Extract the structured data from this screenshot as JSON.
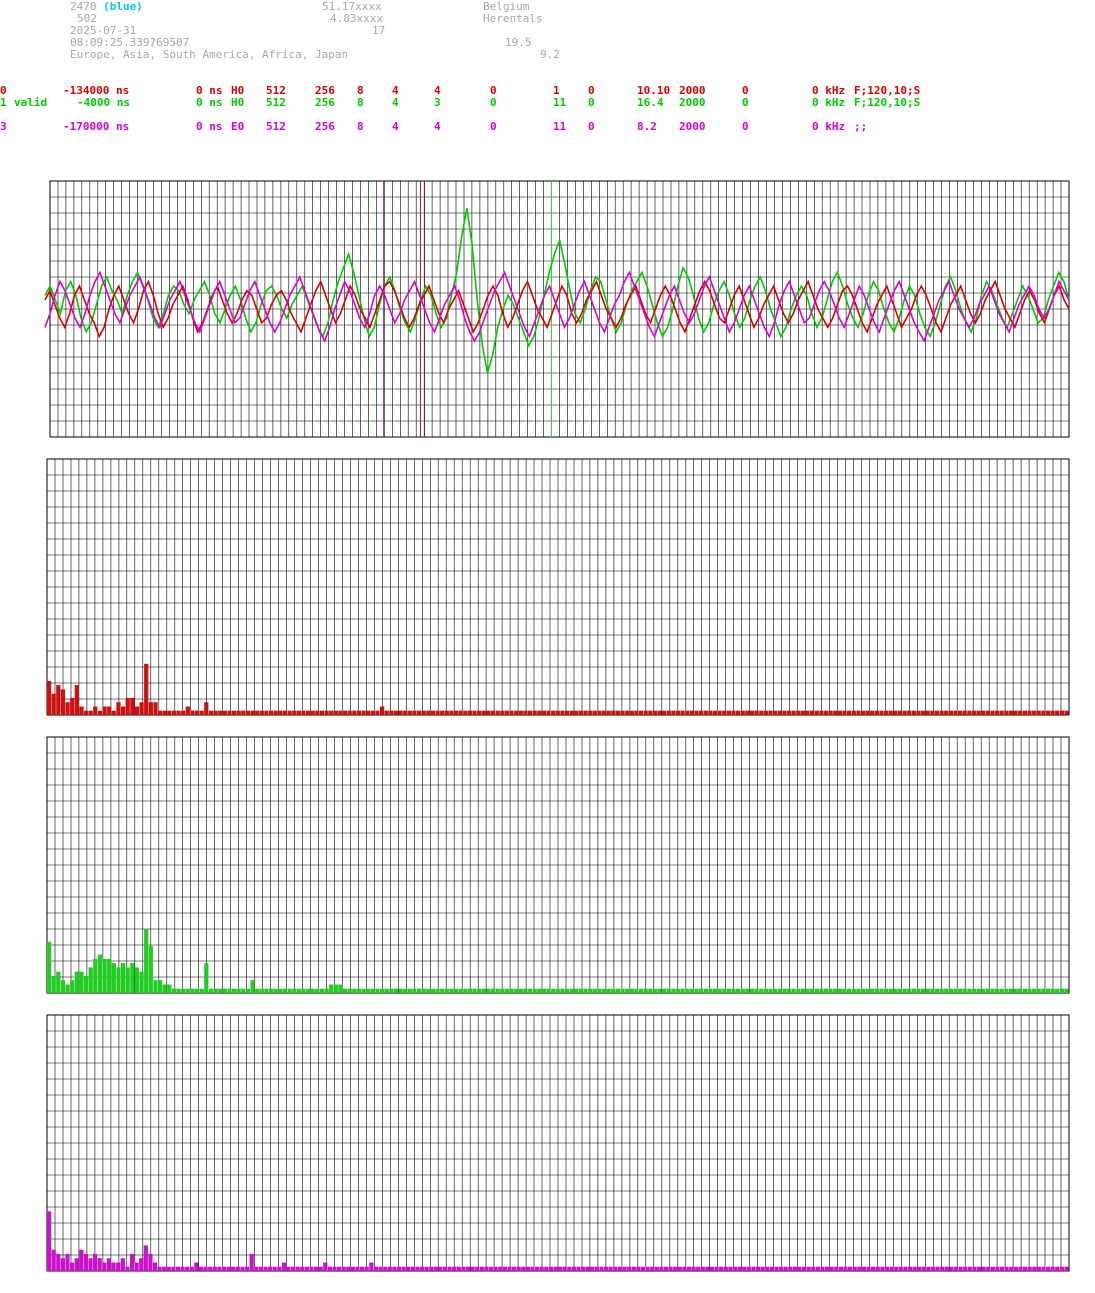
{
  "header": {
    "station_id": "2470",
    "station_color": "(blue)",
    "line2": "502",
    "date": "2025-07-31",
    "time": "08:09:25.339769507",
    "regions": "Europe, Asia, South America, Africa, Japan",
    "lat": "51.17xxxx",
    "lon": "4.83xxxx",
    "alt": "17",
    "country": "Belgium",
    "city": "Herentals",
    "val_a": "19.5",
    "val_b": "9.2"
  },
  "channels": [
    {
      "ch": "0",
      "valid": "",
      "delay": "-134000 ns",
      "off": "0 ns",
      "ant": "H0",
      "c1": "512",
      "c2": "256",
      "c3": "8",
      "c4": "4",
      "c5": "4",
      "c6": "0",
      "c7": "1",
      "c8": "0",
      "c9": "10.10",
      "c10": "2000",
      "c11": "0",
      "freq": "0 kHz",
      "filt": "F;120,10;S",
      "color": "#dd0000"
    },
    {
      "ch": "1",
      "valid": "valid",
      "delay": "-4000 ns",
      "off": "0 ns",
      "ant": "H0",
      "c1": "512",
      "c2": "256",
      "c3": "8",
      "c4": "4",
      "c5": "3",
      "c6": "0",
      "c7": "11",
      "c8": "0",
      "c9": "16.4",
      "c10": "2000",
      "c11": "0",
      "freq": "0 kHz",
      "filt": "F;120,10;S",
      "color": "#00cc00"
    },
    {
      "ch": "3",
      "valid": "",
      "delay": "-170000 ns",
      "off": "0 ns",
      "ant": "E0",
      "c1": "512",
      "c2": "256",
      "c3": "8",
      "c4": "4",
      "c5": "4",
      "c6": "0",
      "c7": "11",
      "c8": "0",
      "c9": "8.2",
      "c10": "2000",
      "c11": "0",
      "freq": "0 kHz",
      "filt": ";;",
      "color": "#dd00dd"
    }
  ],
  "chart_data": [
    {
      "type": "line",
      "grid": true,
      "series": [
        {
          "color": "#00cc00",
          "values": [
            3,
            5,
            2,
            -1,
            4,
            6,
            3,
            -2,
            -5,
            -3,
            1,
            5,
            7,
            4,
            2,
            -1,
            3,
            6,
            8,
            5,
            2,
            -2,
            -4,
            -1,
            3,
            5,
            4,
            1,
            -1,
            2,
            4,
            6,
            3,
            -1,
            -3,
            0,
            3,
            5,
            2,
            -2,
            -5,
            -3,
            1,
            4,
            5,
            3,
            0,
            -2,
            1,
            3,
            5,
            2,
            -1,
            -4,
            -6,
            -3,
            2,
            6,
            9,
            12,
            8,
            3,
            -2,
            -6,
            -4,
            1,
            5,
            7,
            4,
            0,
            -3,
            -5,
            -2,
            2,
            5,
            3,
            -1,
            -4,
            -2,
            3,
            8,
            16,
            22,
            14,
            2,
            -8,
            -14,
            -10,
            -4,
            0,
            3,
            1,
            -2,
            -5,
            -8,
            -6,
            -2,
            3,
            8,
            12,
            15,
            10,
            4,
            -1,
            -3,
            0,
            4,
            7,
            6,
            2,
            -2,
            -5,
            -3,
            1,
            4,
            6,
            8,
            5,
            1,
            -3,
            -6,
            -4,
            0,
            5,
            9,
            7,
            3,
            -2,
            -5,
            -3,
            1,
            4,
            6,
            3,
            -1,
            -4,
            -2,
            2,
            5,
            7,
            4,
            0,
            -3,
            -6,
            -4,
            0,
            3,
            5,
            3,
            -1,
            -4,
            -2,
            2,
            6,
            8,
            5,
            1,
            -2,
            -4,
            -1,
            3,
            6,
            4,
            0,
            -3,
            -5,
            -2,
            2,
            5,
            3,
            -1,
            -4,
            -6,
            -3,
            1,
            5,
            7,
            4,
            0,
            -3,
            -5,
            -2,
            3,
            6,
            4,
            1,
            -2,
            -4,
            -1,
            2,
            5,
            3,
            0,
            -3,
            -2,
            2,
            5,
            8,
            6,
            2
          ]
        },
        {
          "color": "#dd0000",
          "values": [
            2,
            4,
            1,
            -2,
            -4,
            -1,
            3,
            5,
            2,
            -1,
            -3,
            -6,
            -4,
            0,
            3,
            5,
            2,
            -1,
            -3,
            0,
            4,
            6,
            3,
            -1,
            -4,
            -2,
            1,
            3,
            5,
            2,
            -2,
            -5,
            -3,
            0,
            3,
            5,
            2,
            -1,
            -3,
            -1,
            2,
            4,
            3,
            0,
            -3,
            -2,
            1,
            3,
            4,
            2,
            -1,
            -3,
            -5,
            -2,
            1,
            4,
            6,
            3,
            0,
            -3,
            -1,
            2,
            5,
            3,
            0,
            -2,
            -4,
            -1,
            2,
            5,
            6,
            4,
            1,
            -2,
            -4,
            -2,
            1,
            3,
            5,
            2,
            -1,
            -3,
            0,
            2,
            4,
            1,
            -2,
            -5,
            -3,
            0,
            3,
            5,
            3,
            -1,
            -4,
            -2,
            1,
            4,
            6,
            3,
            0,
            -2,
            -4,
            -1,
            2,
            5,
            3,
            -1,
            -3,
            -1,
            2,
            4,
            6,
            3,
            0,
            -2,
            -4,
            -2,
            1,
            3,
            5,
            2,
            -1,
            -3,
            0,
            3,
            5,
            3,
            0,
            -3,
            -5,
            -2,
            1,
            4,
            6,
            4,
            1,
            -2,
            -3,
            0,
            3,
            5,
            2,
            -1,
            -4,
            -2,
            1,
            3,
            5,
            2,
            -1,
            -3,
            -1,
            2,
            4,
            6,
            3,
            0,
            -2,
            -4,
            -2,
            1,
            4,
            5,
            3,
            0,
            -3,
            -5,
            -2,
            1,
            3,
            5,
            2,
            -1,
            -4,
            -2,
            0,
            3,
            5,
            3,
            0,
            -3,
            -5,
            -2,
            1,
            3,
            5,
            2,
            -1,
            -3,
            -1,
            2,
            4,
            6,
            3,
            0,
            -2,
            -4,
            -1,
            2,
            4,
            2,
            -1,
            -3,
            0,
            3,
            5,
            2,
            0
          ]
        },
        {
          "color": "#dd00dd",
          "values": [
            -4,
            -1,
            3,
            6,
            4,
            1,
            -2,
            -4,
            -1,
            3,
            6,
            8,
            5,
            2,
            -1,
            -3,
            0,
            3,
            5,
            7,
            4,
            1,
            -2,
            -4,
            -1,
            2,
            4,
            6,
            3,
            0,
            -3,
            -5,
            -2,
            1,
            4,
            6,
            3,
            0,
            -3,
            -2,
            1,
            4,
            6,
            3,
            0,
            -3,
            -5,
            -3,
            0,
            3,
            5,
            7,
            4,
            1,
            -2,
            -5,
            -7,
            -4,
            0,
            3,
            6,
            4,
            1,
            -2,
            -4,
            -1,
            3,
            5,
            3,
            0,
            -3,
            -1,
            2,
            4,
            6,
            3,
            0,
            -3,
            -5,
            -2,
            1,
            3,
            5,
            2,
            -2,
            -5,
            -7,
            -5,
            -2,
            1,
            4,
            6,
            8,
            5,
            2,
            -1,
            -4,
            -6,
            -3,
            0,
            3,
            5,
            2,
            -1,
            -4,
            -2,
            1,
            4,
            6,
            3,
            0,
            -3,
            -5,
            -2,
            1,
            3,
            6,
            8,
            5,
            2,
            -1,
            -4,
            -6,
            -3,
            0,
            3,
            5,
            2,
            -1,
            -3,
            -1,
            2,
            5,
            7,
            4,
            1,
            -2,
            -5,
            -3,
            0,
            3,
            5,
            2,
            -1,
            -4,
            -6,
            -3,
            1,
            4,
            6,
            3,
            0,
            -3,
            -2,
            1,
            4,
            6,
            4,
            1,
            -2,
            -4,
            -1,
            2,
            5,
            3,
            0,
            -3,
            -5,
            -2,
            1,
            4,
            6,
            3,
            0,
            -3,
            -5,
            -7,
            -4,
            -1,
            2,
            4,
            6,
            3,
            0,
            -2,
            -4,
            -2,
            1,
            3,
            5,
            2,
            -1,
            -3,
            -5,
            -2,
            1,
            3,
            5,
            3,
            0,
            -2,
            0,
            3,
            6,
            4,
            2
          ]
        }
      ],
      "vlines": [
        {
          "x": 0.33,
          "color": "#993399"
        },
        {
          "x": 0.366,
          "color": "#882222"
        },
        {
          "x": 0.37,
          "color": "#882222"
        },
        {
          "x": 0.494,
          "color": "#44dd44"
        }
      ],
      "ylim": [
        -28,
        28
      ]
    },
    {
      "type": "bar",
      "grid": true,
      "color": "#cc1111",
      "values": [
        8,
        5,
        7,
        6,
        3,
        4,
        7,
        2,
        1,
        1,
        2,
        1,
        2,
        2,
        1,
        3,
        2,
        4,
        4,
        2,
        3,
        12,
        3,
        3,
        1,
        1,
        1,
        1,
        1,
        1,
        2,
        1,
        1,
        1,
        3,
        1,
        1,
        1,
        1,
        1,
        1,
        1,
        1,
        1,
        1,
        1,
        1,
        1,
        1,
        1,
        1,
        1,
        1,
        1,
        1,
        1,
        1,
        1,
        1,
        1,
        1,
        1,
        1,
        1,
        1,
        1,
        1,
        1,
        1,
        1,
        1,
        1,
        2,
        1,
        1,
        1,
        1,
        1,
        1,
        1,
        1,
        1,
        1,
        1,
        1,
        1,
        1,
        1,
        1,
        1,
        1,
        1,
        1,
        1,
        1,
        1,
        1,
        1,
        1,
        1,
        1,
        1,
        1,
        1,
        1,
        1,
        1,
        1,
        1,
        1,
        1,
        1,
        1,
        1,
        1,
        1,
        1,
        1,
        1,
        1,
        1,
        1,
        1,
        1,
        1,
        1,
        1,
        1,
        1,
        1,
        1,
        1,
        1,
        1,
        1,
        1,
        1,
        1,
        1,
        1,
        1,
        1,
        1,
        1,
        1,
        1,
        1,
        1,
        1,
        1,
        1,
        1,
        1,
        1,
        1,
        1,
        1,
        1,
        1,
        1,
        1,
        1,
        1,
        1,
        1,
        1,
        1,
        1,
        1,
        1,
        1,
        1,
        1,
        1,
        1,
        1,
        1,
        1,
        1,
        1,
        1,
        1,
        1,
        1,
        1,
        1,
        1,
        1,
        1,
        1,
        1,
        1,
        1,
        1,
        1,
        1,
        1,
        1,
        1,
        1,
        1,
        1,
        1,
        1,
        1,
        1,
        1,
        1,
        1,
        1,
        1,
        1,
        1,
        1,
        1,
        1,
        1,
        1,
        1,
        1,
        1
      ],
      "ylim": [
        0,
        60
      ]
    },
    {
      "type": "bar",
      "grid": true,
      "color": "#22cc22",
      "values": [
        12,
        4,
        5,
        3,
        2,
        3,
        5,
        5,
        4,
        6,
        8,
        9,
        8,
        8,
        7,
        6,
        7,
        6,
        7,
        6,
        5,
        15,
        11,
        3,
        3,
        2,
        2,
        1,
        1,
        1,
        1,
        1,
        1,
        1,
        7,
        1,
        1,
        1,
        1,
        1,
        1,
        1,
        1,
        1,
        3,
        1,
        1,
        1,
        1,
        1,
        1,
        1,
        1,
        1,
        1,
        1,
        1,
        1,
        1,
        1,
        1,
        2,
        2,
        2,
        1,
        1,
        1,
        1,
        1,
        1,
        1,
        1,
        1,
        1,
        1,
        1,
        1,
        1,
        1,
        1,
        1,
        1,
        1,
        1,
        1,
        1,
        1,
        1,
        1,
        1,
        1,
        1,
        1,
        1,
        1,
        1,
        1,
        1,
        1,
        1,
        1,
        1,
        1,
        1,
        1,
        1,
        1,
        1,
        1,
        1,
        1,
        1,
        1,
        1,
        1,
        1,
        1,
        1,
        1,
        1,
        1,
        1,
        1,
        1,
        1,
        1,
        1,
        1,
        1,
        1,
        1,
        1,
        1,
        1,
        1,
        1,
        1,
        1,
        1,
        1,
        1,
        1,
        1,
        1,
        1,
        1,
        1,
        1,
        1,
        1,
        1,
        1,
        1,
        1,
        1,
        1,
        1,
        1,
        1,
        1,
        1,
        1,
        1,
        1,
        1,
        1,
        1,
        1,
        1,
        1,
        1,
        1,
        1,
        1,
        1,
        1,
        1,
        1,
        1,
        1,
        1,
        1,
        1,
        1,
        1,
        1,
        1,
        1,
        1,
        1,
        1,
        1,
        1,
        1,
        1,
        1,
        1,
        1,
        1,
        1,
        1,
        1,
        1,
        1,
        1,
        1,
        1,
        1,
        1,
        1,
        1,
        1,
        1,
        1,
        1,
        1,
        1,
        1,
        1,
        1,
        1
      ],
      "ylim": [
        0,
        60
      ]
    },
    {
      "type": "bar",
      "grid": true,
      "color": "#cc11cc",
      "values": [
        14,
        5,
        4,
        3,
        4,
        2,
        3,
        5,
        4,
        3,
        4,
        3,
        2,
        3,
        2,
        2,
        3,
        1,
        4,
        2,
        3,
        6,
        4,
        2,
        1,
        1,
        1,
        1,
        1,
        1,
        1,
        1,
        2,
        1,
        1,
        1,
        1,
        1,
        1,
        1,
        1,
        1,
        1,
        1,
        4,
        1,
        1,
        1,
        1,
        1,
        1,
        2,
        1,
        1,
        1,
        1,
        1,
        1,
        1,
        1,
        2,
        1,
        1,
        1,
        1,
        1,
        1,
        1,
        1,
        1,
        2,
        1,
        1,
        1,
        1,
        1,
        1,
        1,
        1,
        1,
        1,
        1,
        1,
        1,
        1,
        1,
        1,
        1,
        1,
        1,
        1,
        1,
        1,
        1,
        1,
        1,
        1,
        1,
        1,
        1,
        1,
        1,
        1,
        1,
        1,
        1,
        1,
        1,
        1,
        1,
        1,
        1,
        1,
        1,
        1,
        1,
        1,
        1,
        1,
        1,
        1,
        1,
        1,
        1,
        1,
        1,
        1,
        1,
        1,
        1,
        1,
        1,
        1,
        1,
        1,
        1,
        1,
        1,
        1,
        1,
        1,
        1,
        1,
        1,
        1,
        1,
        1,
        1,
        1,
        1,
        1,
        1,
        1,
        1,
        1,
        1,
        1,
        1,
        1,
        1,
        1,
        1,
        1,
        1,
        1,
        1,
        1,
        1,
        1,
        1,
        1,
        1,
        1,
        1,
        1,
        1,
        1,
        1,
        1,
        1,
        1,
        1,
        1,
        1,
        1,
        1,
        1,
        1,
        1,
        1,
        1,
        1,
        1,
        1,
        1,
        1,
        1,
        1,
        1,
        1,
        1,
        1,
        1,
        1,
        1,
        1,
        1,
        1,
        1,
        1,
        1,
        1,
        1,
        1,
        1,
        1,
        1,
        1,
        1,
        1,
        1,
        1
      ],
      "ylim": [
        0,
        60
      ]
    }
  ]
}
